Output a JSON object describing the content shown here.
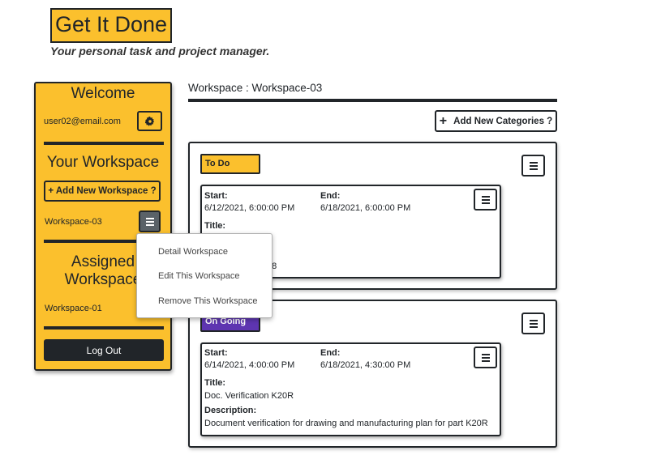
{
  "brand": {
    "title": "Get It Done",
    "tagline": "Your personal task and project manager."
  },
  "sidebar": {
    "welcome_heading": "Welcome",
    "user_email": "user02@email.com",
    "gear_icon": "gear-icon",
    "your_workspace_heading": "Your Workspace",
    "add_workspace_label": "+ Add New Workspace ?",
    "workspaces": [
      {
        "name": "Workspace-03"
      }
    ],
    "assigned_heading_line1": "Assigned",
    "assigned_heading_line2": "Workspace",
    "assigned_workspaces": [
      {
        "name": "Workspace-01"
      }
    ],
    "logout_label": "Log Out"
  },
  "dropdown": {
    "items": [
      "Detail Workspace",
      "Edit This Workspace",
      "Remove This Workspace"
    ]
  },
  "main": {
    "workspace_title": "Workspace : Workspace-03",
    "add_category_label": "Add New Categories ?",
    "categories": [
      {
        "name": "To Do",
        "color": "#fbc02d",
        "text_color": "#212529",
        "task": {
          "start_label": "Start:",
          "start_value": "6/12/2021, 6:00:00 PM",
          "end_label": "End:",
          "end_value": "6/18/2021, 6:00:00 PM",
          "title_label": "Title:",
          "visible_fragment": "t 8"
        }
      },
      {
        "name": "On Going",
        "color": "#5e35b1",
        "text_color": "#ffffff",
        "task": {
          "start_label": "Start:",
          "start_value": "6/14/2021, 4:00:00 PM",
          "end_label": "End:",
          "end_value": "6/18/2021, 4:30:00 PM",
          "title_label": "Title:",
          "title_value": "Doc. Verification K20R",
          "description_label": "Description:",
          "description_value": "Document verification for drawing and manufacturing plan for part K20R"
        }
      }
    ]
  },
  "colors": {
    "accent": "#fbc02d",
    "dark": "#212529",
    "menu_active": "#5a6268"
  }
}
